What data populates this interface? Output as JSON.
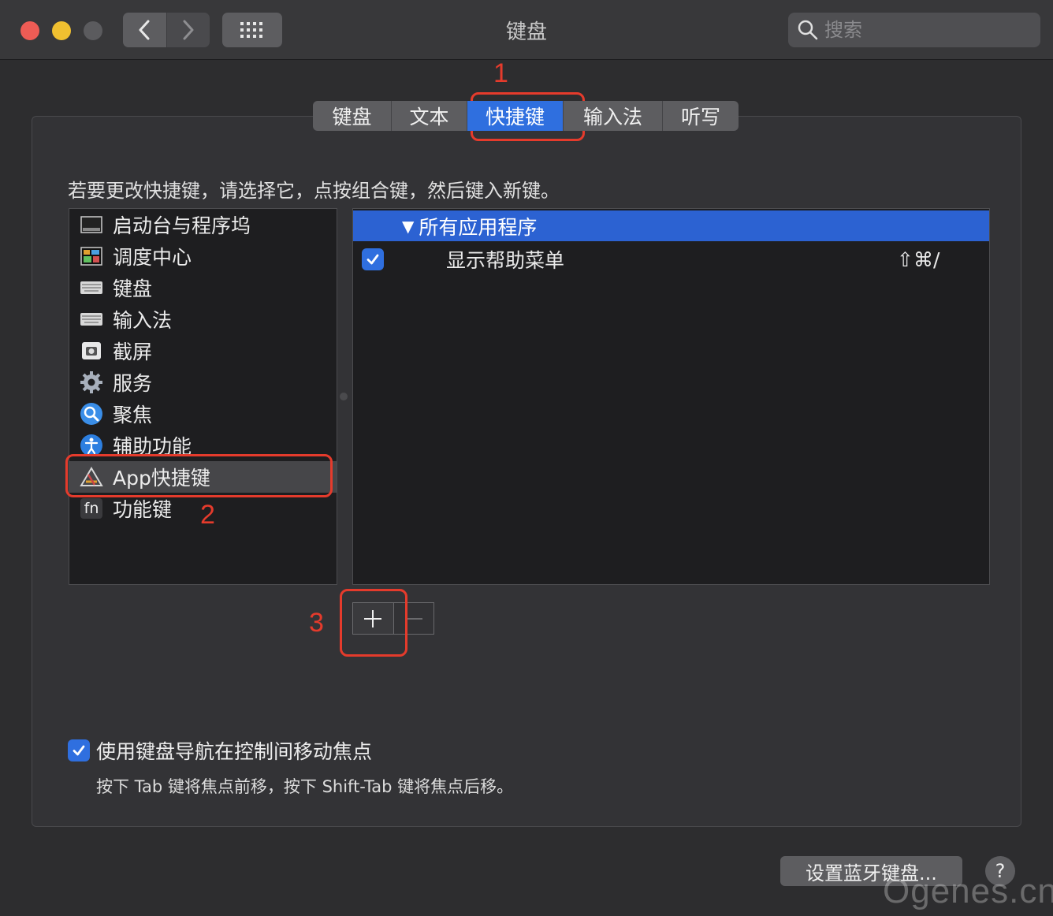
{
  "window": {
    "title": "键盘"
  },
  "toolbar": {
    "back_icon": "chevron-left-icon",
    "forward_icon": "chevron-right-icon",
    "grid_icon": "grid-icon",
    "search_placeholder": "搜索"
  },
  "tabs": [
    {
      "label": "键盘",
      "active": false
    },
    {
      "label": "文本",
      "active": false
    },
    {
      "label": "快捷键",
      "active": true
    },
    {
      "label": "输入法",
      "active": false
    },
    {
      "label": "听写",
      "active": false
    }
  ],
  "instruction": "若要更改快捷键，请选择它，点按组合键，然后键入新键。",
  "categories": [
    {
      "label": "启动台与程序坞",
      "icon": "dock-icon"
    },
    {
      "label": "调度中心",
      "icon": "mission-control-icon"
    },
    {
      "label": "键盘",
      "icon": "keyboard-icon"
    },
    {
      "label": "输入法",
      "icon": "keyboard-icon"
    },
    {
      "label": "截屏",
      "icon": "screenshot-icon"
    },
    {
      "label": "服务",
      "icon": "gear-icon"
    },
    {
      "label": "聚焦",
      "icon": "spotlight-icon"
    },
    {
      "label": "辅助功能",
      "icon": "accessibility-icon"
    },
    {
      "label": "App快捷键",
      "icon": "app-shortcuts-icon",
      "selected": true
    },
    {
      "label": "功能键",
      "icon": "fn-icon",
      "icon_text": "fn"
    }
  ],
  "shortcuts": {
    "group_label": "所有应用程序",
    "rows": [
      {
        "checked": true,
        "label": "显示帮助菜单",
        "keys": "⇧⌘/"
      }
    ]
  },
  "buttons": {
    "add": "+",
    "remove": "−"
  },
  "annotations": [
    "1",
    "2",
    "3"
  ],
  "keyboard_nav": {
    "checked": true,
    "label": "使用键盘导航在控制间移动焦点",
    "note": "按下 Tab 键将焦点前移，按下 Shift-Tab 键将焦点后移。"
  },
  "footer": {
    "bluetooth_button": "设置蓝牙键盘...",
    "help": "?"
  },
  "watermark": "Ogenes.cn",
  "colors": {
    "accent": "#2f6fdf",
    "annotation": "#e53b2c",
    "background": "#2d2d2f"
  }
}
